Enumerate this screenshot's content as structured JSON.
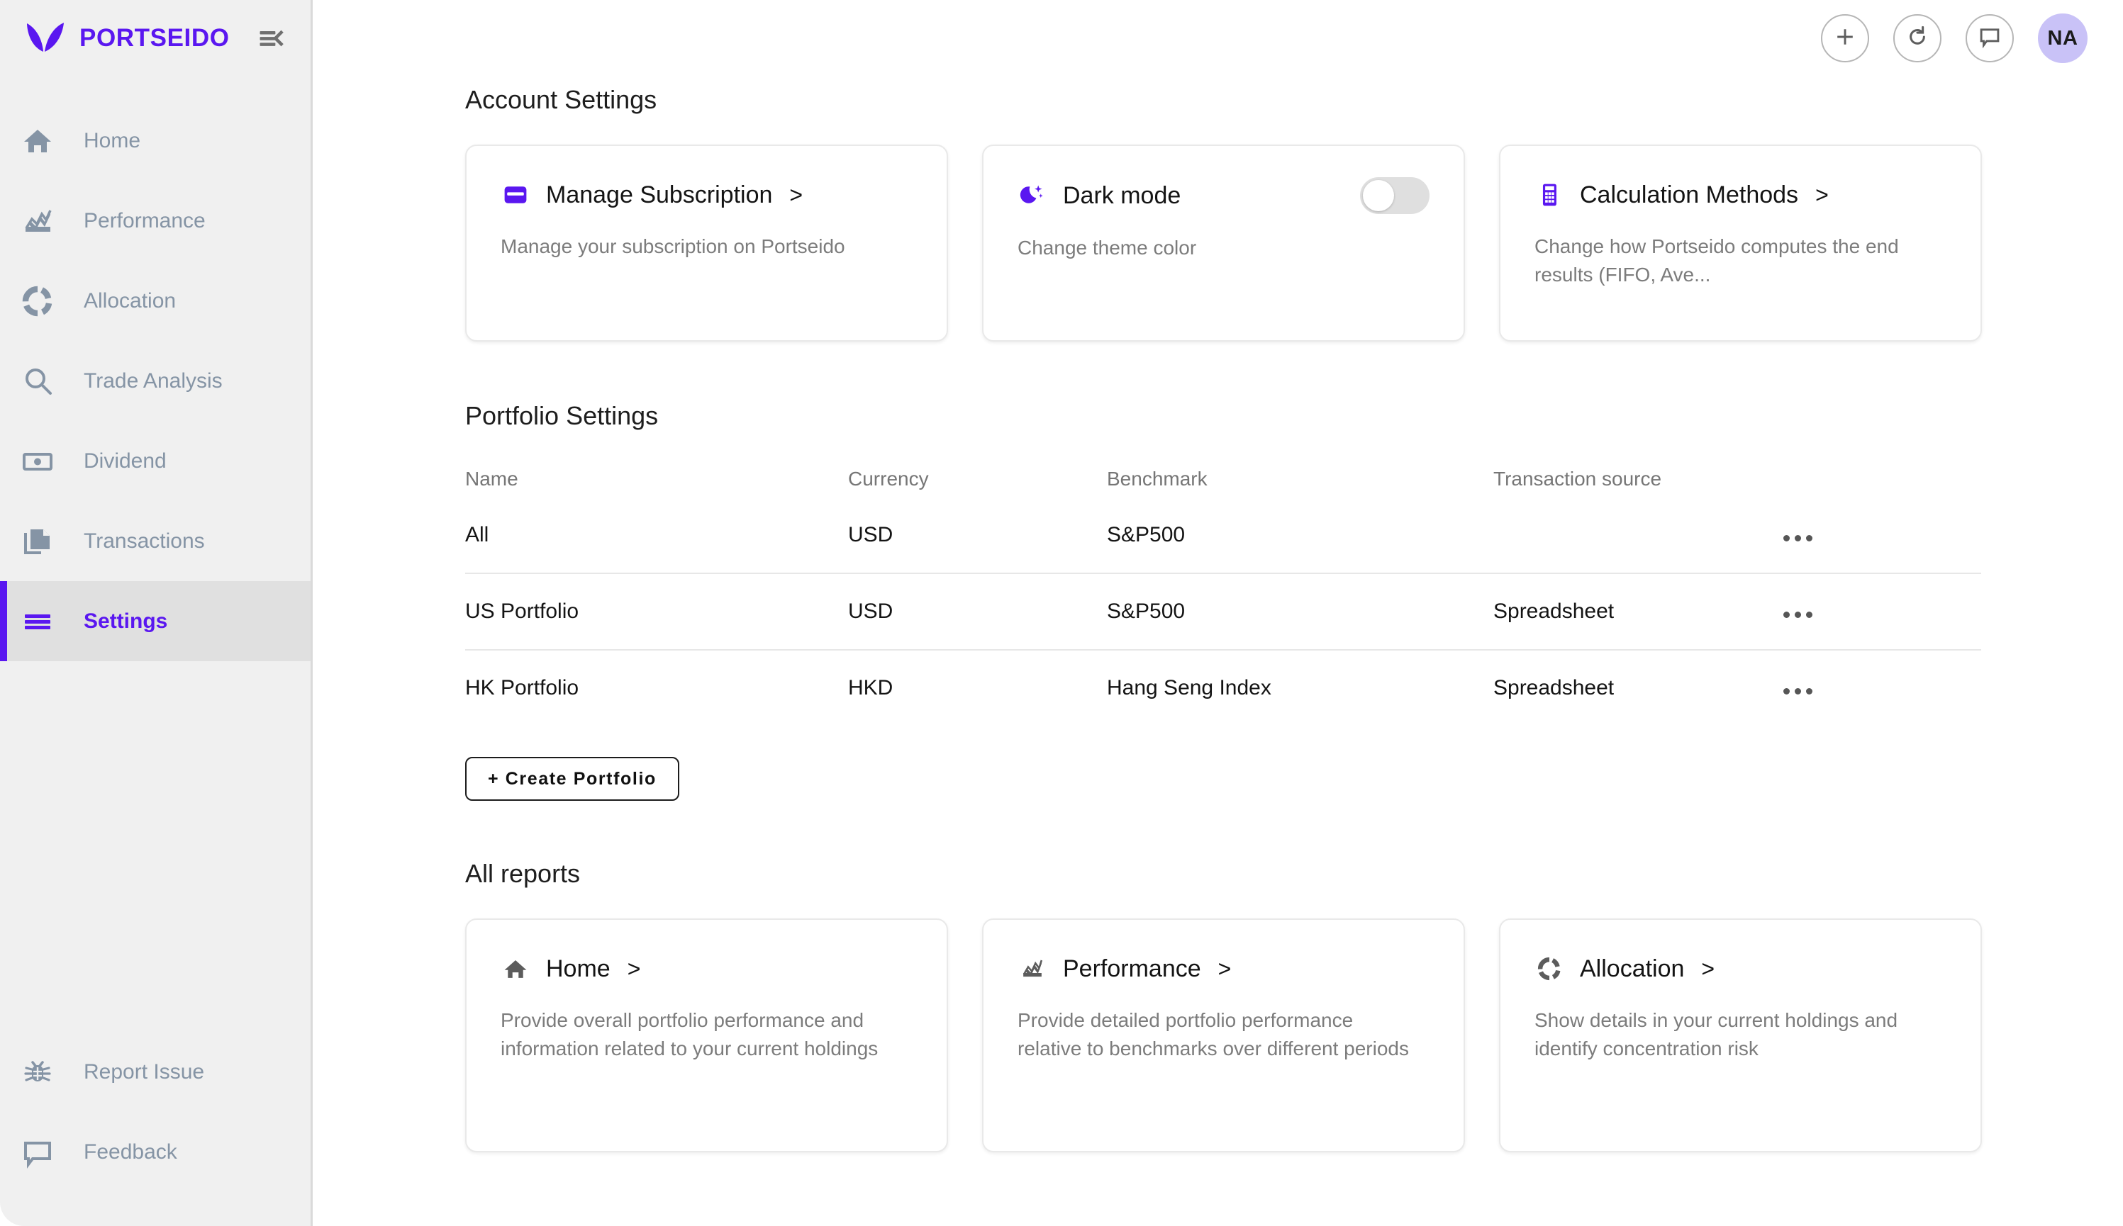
{
  "brand": {
    "name": "PORTSEIDO",
    "logo_icon": "leaf-logo-icon",
    "collapse_icon": "sidebar-collapse-icon",
    "accent_color": "#5a17f0"
  },
  "sidebar": {
    "items": [
      {
        "label": "Home",
        "icon": "home-icon",
        "active": false
      },
      {
        "label": "Performance",
        "icon": "line-chart-icon",
        "active": false
      },
      {
        "label": "Allocation",
        "icon": "donut-chart-icon",
        "active": false
      },
      {
        "label": "Trade Analysis",
        "icon": "magnifier-icon",
        "active": false
      },
      {
        "label": "Dividend",
        "icon": "banknote-icon",
        "active": false
      },
      {
        "label": "Transactions",
        "icon": "documents-icon",
        "active": false
      },
      {
        "label": "Settings",
        "icon": "hamburger-icon",
        "active": true
      }
    ],
    "bottom_items": [
      {
        "label": "Report Issue",
        "icon": "bug-icon"
      },
      {
        "label": "Feedback",
        "icon": "chat-bubble-icon"
      }
    ]
  },
  "topbar": {
    "add_icon": "plus-icon",
    "refresh_icon": "refresh-icon",
    "chat_icon": "chat-bubble-icon",
    "avatar_initials": "NA",
    "avatar_color": "#c9c2f7"
  },
  "account_settings": {
    "title": "Account Settings",
    "cards": [
      {
        "icon": "credit-card-icon",
        "title": "Manage Subscription",
        "chevron": ">",
        "desc": "Manage your subscription on Portseido",
        "has_toggle": false
      },
      {
        "icon": "moon-stars-icon",
        "title": "Dark mode",
        "chevron": "",
        "desc": "Change theme color",
        "has_toggle": true,
        "toggle_on": false
      },
      {
        "icon": "calculator-icon",
        "title": "Calculation Methods",
        "chevron": ">",
        "desc": "Change how Portseido computes the end results (FIFO, Ave...",
        "has_toggle": false
      }
    ]
  },
  "portfolio_settings": {
    "title": "Portfolio Settings",
    "columns": [
      "Name",
      "Currency",
      "Benchmark",
      "Transaction source",
      ""
    ],
    "rows": [
      {
        "name": "All",
        "currency": "USD",
        "benchmark": "S&P500",
        "source": "",
        "menu_icon": "more-options-icon"
      },
      {
        "name": "US Portfolio",
        "currency": "USD",
        "benchmark": "S&P500",
        "source": "Spreadsheet",
        "menu_icon": "more-options-icon"
      },
      {
        "name": "HK Portfolio",
        "currency": "HKD",
        "benchmark": "Hang Seng Index",
        "source": "Spreadsheet",
        "menu_icon": "more-options-icon"
      }
    ],
    "create_button": "+ Create Portfolio"
  },
  "all_reports": {
    "title": "All reports",
    "cards": [
      {
        "icon": "home-icon",
        "title": "Home",
        "chevron": ">",
        "desc": "Provide overall portfolio performance and information related to your current holdings"
      },
      {
        "icon": "line-chart-icon",
        "title": "Performance",
        "chevron": ">",
        "desc": "Provide detailed portfolio performance relative to benchmarks over different periods"
      },
      {
        "icon": "donut-chart-icon",
        "title": "Allocation",
        "chevron": ">",
        "desc": "Show details in your current holdings and identify concentration risk"
      }
    ]
  }
}
